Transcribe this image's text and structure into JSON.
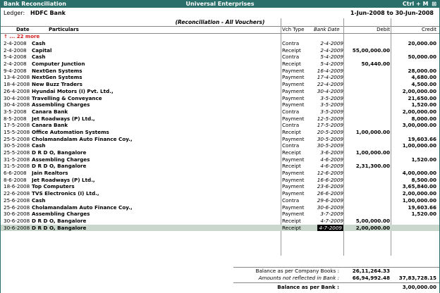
{
  "titlebar": {
    "left": "Bank Reconciliation",
    "center": "Universal Enterprises",
    "shortcut": "Ctrl + M",
    "close_glyph": "⊠"
  },
  "ledger": {
    "label": "Ledger:",
    "name": "HDFC Bank",
    "period": "1-Jun-2008 to 30-Jun-2008"
  },
  "subtitle": "(Reconciliation - All Vouchers)",
  "columns": {
    "date": "Date",
    "particulars": "Particulars",
    "vch_type": "Vch Type",
    "bank_date": "Bank Date",
    "debit": "Debit",
    "credit": "Credit"
  },
  "more_indicator": "↑ ... 22 more",
  "rows": [
    {
      "date": "2-4-2008",
      "particulars": "Cash",
      "vch": "Contra",
      "bank_date": "2-4-2009",
      "debit": "",
      "credit": "20,000.00"
    },
    {
      "date": "2-4-2008",
      "particulars": "Capital",
      "vch": "Receipt",
      "bank_date": "2-4-2009",
      "debit": "55,00,000.00",
      "credit": ""
    },
    {
      "date": "5-4-2008",
      "particulars": "Cash",
      "vch": "Contra",
      "bank_date": "5-4-2009",
      "debit": "",
      "credit": "50,000.00"
    },
    {
      "date": "2-4-2008",
      "particulars": "Computer Junction",
      "vch": "Receipt",
      "bank_date": "5-4-2009",
      "debit": "50,440.00",
      "credit": ""
    },
    {
      "date": "9-4-2008",
      "particulars": "NextGen Systems",
      "vch": "Payment",
      "bank_date": "16-4-2009",
      "debit": "",
      "credit": "28,000.00"
    },
    {
      "date": "13-4-2008",
      "particulars": "NextGen Systems",
      "vch": "Payment",
      "bank_date": "17-4-2009",
      "debit": "",
      "credit": "4,680.00"
    },
    {
      "date": "18-4-2008",
      "particulars": "New Buzz Traders",
      "vch": "Payment",
      "bank_date": "22-4-2009",
      "debit": "",
      "credit": "4,500.00"
    },
    {
      "date": "26-4-2008",
      "particulars": "Hyundai Motors (I) Pvt. Ltd.,",
      "vch": "Payment",
      "bank_date": "30-4-2009",
      "debit": "",
      "credit": "2,00,000.00"
    },
    {
      "date": "30-4-2008",
      "particulars": "Travelling & Conveyance",
      "vch": "Payment",
      "bank_date": "3-5-2009",
      "debit": "",
      "credit": "21,650.00"
    },
    {
      "date": "30-4-2008",
      "particulars": "Assembling Charges",
      "vch": "Payment",
      "bank_date": "3-5-2009",
      "debit": "",
      "credit": "1,520.00"
    },
    {
      "date": "3-5-2008",
      "particulars": "Canara Bank",
      "vch": "Contra",
      "bank_date": "3-5-2009",
      "debit": "",
      "credit": "2,00,000.00"
    },
    {
      "date": "8-5-2008",
      "particulars": "Jet Roadways (P) Ltd.,",
      "vch": "Payment",
      "bank_date": "12-5-2009",
      "debit": "",
      "credit": "8,000.00"
    },
    {
      "date": "17-5-2008",
      "particulars": "Canara Bank",
      "vch": "Contra",
      "bank_date": "17-5-2009",
      "debit": "",
      "credit": "3,00,000.00"
    },
    {
      "date": "15-5-2008",
      "particulars": "Office Automation Systems",
      "vch": "Receipt",
      "bank_date": "20-5-2009",
      "debit": "1,00,000.00",
      "credit": ""
    },
    {
      "date": "25-5-2008",
      "particulars": "Cholamandalam Auto Finance Coy.,",
      "vch": "Payment",
      "bank_date": "30-5-2009",
      "debit": "",
      "credit": "19,603.66"
    },
    {
      "date": "30-5-2008",
      "particulars": "Cash",
      "vch": "Contra",
      "bank_date": "30-5-2009",
      "debit": "",
      "credit": "1,00,000.00"
    },
    {
      "date": "25-5-2008",
      "particulars": "D R D O, Bangalore",
      "vch": "Receipt",
      "bank_date": "3-6-2009",
      "debit": "1,00,000.00",
      "credit": ""
    },
    {
      "date": "31-5-2008",
      "particulars": "Assembling Charges",
      "vch": "Payment",
      "bank_date": "4-6-2009",
      "debit": "",
      "credit": "1,520.00"
    },
    {
      "date": "31-5-2008",
      "particulars": "D R D O, Bangalore",
      "vch": "Receipt",
      "bank_date": "4-6-2009",
      "debit": "2,31,300.00",
      "credit": ""
    },
    {
      "date": "6-6-2008",
      "particulars": "Jain Realtors",
      "vch": "Payment",
      "bank_date": "12-6-2009",
      "debit": "",
      "credit": "4,00,000.00"
    },
    {
      "date": "8-6-2008",
      "particulars": "Jet Roadways (P) Ltd.,",
      "vch": "Payment",
      "bank_date": "16-6-2009",
      "debit": "",
      "credit": "8,500.00"
    },
    {
      "date": "18-6-2008",
      "particulars": "Top Computers",
      "vch": "Payment",
      "bank_date": "23-6-2009",
      "debit": "",
      "credit": "3,65,840.00"
    },
    {
      "date": "22-6-2008",
      "particulars": "TVS Electronics (I) Ltd.,",
      "vch": "Payment",
      "bank_date": "26-6-2009",
      "debit": "",
      "credit": "2,00,000.00"
    },
    {
      "date": "25-6-2008",
      "particulars": "Cash",
      "vch": "Contra",
      "bank_date": "29-6-2009",
      "debit": "",
      "credit": "1,00,000.00"
    },
    {
      "date": "25-6-2008",
      "particulars": "Cholamandalam Auto Finance Coy.,",
      "vch": "Payment",
      "bank_date": "30-6-2009",
      "debit": "",
      "credit": "19,603.66"
    },
    {
      "date": "30-6-2008",
      "particulars": "Assembling Charges",
      "vch": "Payment",
      "bank_date": "3-7-2009",
      "debit": "",
      "credit": "1,520.00"
    },
    {
      "date": "30-6-2008",
      "particulars": "D R D O, Bangalore",
      "vch": "Receipt",
      "bank_date": "4-7-2009",
      "debit": "5,00,000.00",
      "credit": ""
    },
    {
      "date": "30-6-2008",
      "particulars": "D R D O, Bangalore",
      "vch": "Receipt",
      "bank_date": "4-7-2009",
      "debit": "2,00,000.00",
      "credit": "",
      "selected": true
    }
  ],
  "summary": {
    "company_books_label": "Balance as per Company Books :",
    "company_books_debit": "26,11,264.33",
    "not_reflected_label": "Amounts not reflected in Bank :",
    "not_reflected_debit": "66,94,992.48",
    "not_reflected_credit": "37,83,728.15",
    "bank_label": "Balance as per Bank :",
    "bank_credit": "3,00,000.00"
  }
}
